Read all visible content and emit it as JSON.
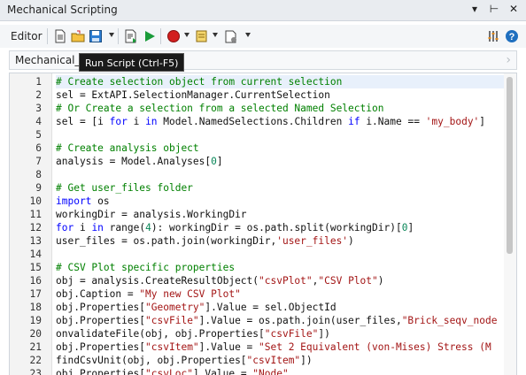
{
  "window": {
    "title": "Mechanical Scripting",
    "controls": [
      "▾",
      "⊢",
      "✕"
    ]
  },
  "toolbar": {
    "editor_label": "Editor",
    "icons": [
      "new-script-icon",
      "open-folder-icon",
      "save-icon",
      "run-script-icon",
      "play-icon",
      "record-icon",
      "snippet-icon",
      "debug-icon",
      "settings-icon",
      "help-icon"
    ]
  },
  "tab": {
    "name": "Mechanical_S"
  },
  "tooltip": {
    "text": "Run Script (Ctrl-F5)"
  },
  "colors": {
    "accent_blue": "#1f6fbf",
    "run_green": "#1a9b3a",
    "record_red": "#d21f1f",
    "comment_green": "#008000",
    "keyword_blue": "#0000ff",
    "string_red": "#a31515"
  },
  "code": {
    "lines": [
      {
        "n": "1",
        "segments": [
          {
            "t": "# Create selection object from current selection",
            "c": "cm"
          }
        ]
      },
      {
        "n": "2",
        "segments": [
          {
            "t": "sel = ExtAPI.SelectionManager.CurrentSelection",
            "c": ""
          }
        ]
      },
      {
        "n": "3",
        "segments": [
          {
            "t": "# Or Create a selection from a selected Named Selection",
            "c": "cm"
          }
        ]
      },
      {
        "n": "4",
        "segments": [
          {
            "t": "sel = [i ",
            "c": ""
          },
          {
            "t": "for",
            "c": "kw"
          },
          {
            "t": " i ",
            "c": ""
          },
          {
            "t": "in",
            "c": "kw"
          },
          {
            "t": " Model.NamedSelections.Children ",
            "c": ""
          },
          {
            "t": "if",
            "c": "kw"
          },
          {
            "t": " i.Name == ",
            "c": ""
          },
          {
            "t": "'my_body'",
            "c": "st"
          },
          {
            "t": "]",
            "c": ""
          }
        ]
      },
      {
        "n": "5",
        "segments": [
          {
            "t": "",
            "c": ""
          }
        ]
      },
      {
        "n": "6",
        "segments": [
          {
            "t": "# Create analysis object",
            "c": "cm"
          }
        ]
      },
      {
        "n": "7",
        "segments": [
          {
            "t": "analysis = Model.Analyses[",
            "c": ""
          },
          {
            "t": "0",
            "c": "num"
          },
          {
            "t": "]",
            "c": ""
          }
        ]
      },
      {
        "n": "8",
        "segments": [
          {
            "t": "",
            "c": ""
          }
        ]
      },
      {
        "n": "9",
        "segments": [
          {
            "t": "# Get user_files folder",
            "c": "cm"
          }
        ]
      },
      {
        "n": "10",
        "segments": [
          {
            "t": "import",
            "c": "kw"
          },
          {
            "t": " os",
            "c": ""
          }
        ]
      },
      {
        "n": "11",
        "segments": [
          {
            "t": "workingDir = analysis.WorkingDir",
            "c": ""
          }
        ]
      },
      {
        "n": "12",
        "segments": [
          {
            "t": "for",
            "c": "kw"
          },
          {
            "t": " i ",
            "c": ""
          },
          {
            "t": "in",
            "c": "kw"
          },
          {
            "t": " range(",
            "c": ""
          },
          {
            "t": "4",
            "c": "num"
          },
          {
            "t": "): workingDir = os.path.split(workingDir)[",
            "c": ""
          },
          {
            "t": "0",
            "c": "num"
          },
          {
            "t": "]",
            "c": ""
          }
        ]
      },
      {
        "n": "13",
        "segments": [
          {
            "t": "user_files = os.path.join(workingDir,",
            "c": ""
          },
          {
            "t": "'user_files'",
            "c": "st"
          },
          {
            "t": ")",
            "c": ""
          }
        ]
      },
      {
        "n": "14",
        "segments": [
          {
            "t": "",
            "c": ""
          }
        ]
      },
      {
        "n": "15",
        "segments": [
          {
            "t": "# CSV Plot specific properties",
            "c": "cm"
          }
        ]
      },
      {
        "n": "16",
        "segments": [
          {
            "t": "obj = analysis.CreateResultObject(",
            "c": ""
          },
          {
            "t": "\"csvPlot\"",
            "c": "st"
          },
          {
            "t": ",",
            "c": ""
          },
          {
            "t": "\"CSV Plot\"",
            "c": "st"
          },
          {
            "t": ")",
            "c": ""
          }
        ]
      },
      {
        "n": "17",
        "segments": [
          {
            "t": "obj.Caption = ",
            "c": ""
          },
          {
            "t": "\"My new CSV Plot\"",
            "c": "st"
          }
        ]
      },
      {
        "n": "18",
        "segments": [
          {
            "t": "obj.Properties[",
            "c": ""
          },
          {
            "t": "\"Geometry\"",
            "c": "st"
          },
          {
            "t": "].Value = sel.ObjectId",
            "c": ""
          }
        ]
      },
      {
        "n": "19",
        "segments": [
          {
            "t": "obj.Properties[",
            "c": ""
          },
          {
            "t": "\"csvFile\"",
            "c": "st"
          },
          {
            "t": "].Value = os.path.join(user_files,",
            "c": ""
          },
          {
            "t": "\"Brick_seqv_node",
            "c": "st"
          }
        ]
      },
      {
        "n": "20",
        "segments": [
          {
            "t": "onvalidateFile(obj, obj.Properties[",
            "c": ""
          },
          {
            "t": "\"csvFile\"",
            "c": "st"
          },
          {
            "t": "])",
            "c": ""
          }
        ]
      },
      {
        "n": "21",
        "segments": [
          {
            "t": "obj.Properties[",
            "c": ""
          },
          {
            "t": "\"csvItem\"",
            "c": "st"
          },
          {
            "t": "].Value = ",
            "c": ""
          },
          {
            "t": "\"Set 2 Equivalent (von-Mises) Stress (M",
            "c": "st"
          }
        ]
      },
      {
        "n": "22",
        "segments": [
          {
            "t": "findCsvUnit(obj, obj.Properties[",
            "c": ""
          },
          {
            "t": "\"csvItem\"",
            "c": "st"
          },
          {
            "t": "])",
            "c": ""
          }
        ]
      },
      {
        "n": "23",
        "segments": [
          {
            "t": "obj.Properties[",
            "c": ""
          },
          {
            "t": "\"csvLoc\"",
            "c": "st"
          },
          {
            "t": "].Value = ",
            "c": ""
          },
          {
            "t": "\"Node\"",
            "c": "st"
          }
        ]
      }
    ]
  }
}
